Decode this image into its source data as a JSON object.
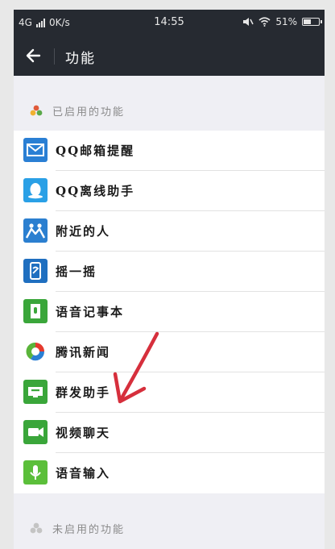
{
  "status_bar": {
    "network": "4G",
    "speed": "0K/s",
    "time": "14:55",
    "battery": "51%",
    "battery_level": 0.51
  },
  "nav": {
    "title": "功能"
  },
  "sections": {
    "enabled_label": "已启用的功能",
    "disabled_label": "未启用的功能"
  },
  "features": [
    {
      "label": "QQ邮箱提醒",
      "icon": "mail-icon",
      "color": "#2a7fd4"
    },
    {
      "label": "QQ离线助手",
      "icon": "qq-penguin-icon",
      "color": "#2aa0e6"
    },
    {
      "label": "附近的人",
      "icon": "people-nearby-icon",
      "color": "#2b7fd0"
    },
    {
      "label": "摇一摇",
      "icon": "shake-phone-icon",
      "color": "#1f6fc0"
    },
    {
      "label": "语音记事本",
      "icon": "voice-notepad-icon",
      "color": "#3aa63a"
    },
    {
      "label": "腾讯新闻",
      "icon": "tencent-news-icon",
      "color": "#f0a020"
    },
    {
      "label": "群发助手",
      "icon": "broadcast-icon",
      "color": "#3aa63a"
    },
    {
      "label": "视频聊天",
      "icon": "video-chat-icon",
      "color": "#3aa63a"
    },
    {
      "label": "语音输入",
      "icon": "microphone-icon",
      "color": "#5bbf3a"
    }
  ],
  "colors": {
    "nav_background": "#262a31",
    "page_background": "#efeff4",
    "annotation_arrow": "#d62f3c"
  }
}
